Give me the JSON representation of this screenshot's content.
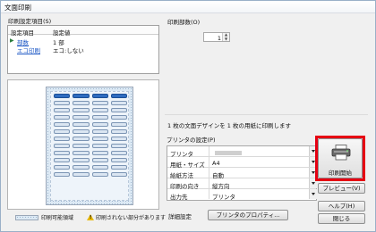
{
  "window": {
    "title": "文面印刷"
  },
  "settings": {
    "group_label": "印刷設定項目(S)",
    "columns": [
      "設定項目",
      "設定値"
    ],
    "rows": [
      {
        "item": "部数",
        "value": "1 部",
        "selected": true
      },
      {
        "item": "エコ印刷",
        "value": "エコ:しない",
        "link": true
      }
    ]
  },
  "copies": {
    "label": "印刷部数(O)",
    "value": "1"
  },
  "preview": {
    "legend_printable": "印刷可能領域",
    "legend_warning": "印刷されない部分があります"
  },
  "info_text": "1 枚の文面デザインを 1 枚の用紙に印刷します",
  "printer_settings": {
    "group_label": "プリンタの設定(P)",
    "rows": [
      {
        "key": "プリンタ",
        "value": ""
      },
      {
        "key": "用紙・サイズ",
        "value": "A4"
      },
      {
        "key": "給紙方法",
        "value": "自動"
      },
      {
        "key": "印刷の向き",
        "value": "縦方向"
      },
      {
        "key": "出力先",
        "value": "プリンタ"
      }
    ],
    "detail_label": "詳細設定",
    "properties_button": "プリンタのプロパティ..."
  },
  "buttons": {
    "print": "印刷開始",
    "preview": "プレビュー(V)",
    "help": "ヘルプ(H)",
    "close": "閉じる"
  },
  "colors": {
    "highlight_frame": "#e60012",
    "label_selected": "#2f6cc0"
  },
  "icons": {
    "print": "printer-icon",
    "warning": "warning-icon",
    "selected_row": "play-arrow-icon"
  }
}
